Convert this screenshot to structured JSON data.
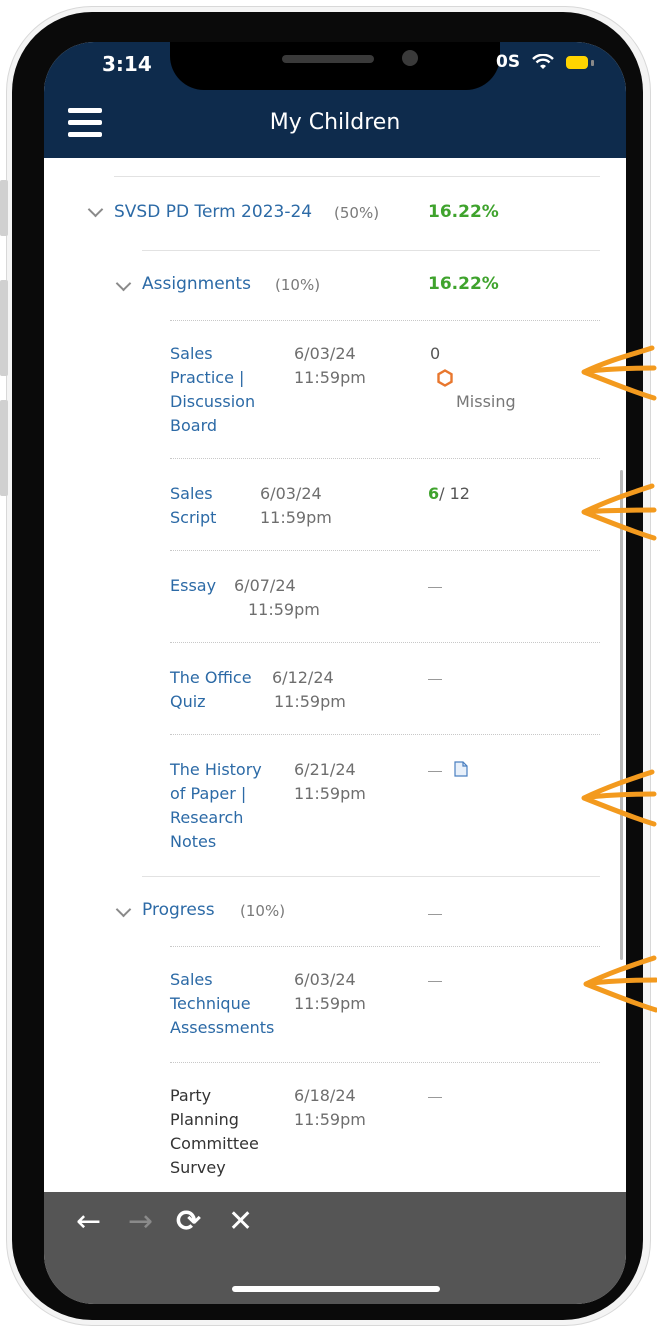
{
  "status": {
    "time": "3:14",
    "carrier_fragment": "0S"
  },
  "header": {
    "title": "My Children"
  },
  "term": {
    "name": "SVSD PD Term 2023-24",
    "weight": "(50%)",
    "grade": "16.22%"
  },
  "categories": [
    {
      "name": "Assignments",
      "weight": "(10%)",
      "grade": "16.22%",
      "items": [
        {
          "title_lines": [
            "Sales",
            "Practice |",
            "Discussion",
            "Board"
          ],
          "date": "6/03/24",
          "time": "11:59pm",
          "score": "0",
          "status": "Missing"
        },
        {
          "title_lines": [
            "Sales",
            "Script"
          ],
          "date": "6/03/24",
          "time": "11:59pm",
          "earned": "6",
          "possible": "/ 12"
        },
        {
          "title_lines": [
            "Essay"
          ],
          "date": "6/07/24",
          "time": "11:59pm"
        },
        {
          "title_lines": [
            "The Office",
            "Quiz"
          ],
          "date": "6/12/24",
          "time": "11:59pm"
        },
        {
          "title_lines": [
            "The History",
            "of Paper |",
            "Research",
            "Notes"
          ],
          "date": "6/21/24",
          "time": "11:59pm"
        }
      ]
    },
    {
      "name": "Progress",
      "weight": "(10%)",
      "items": [
        {
          "title_lines": [
            "Sales",
            "Technique",
            "Assessments"
          ],
          "date": "6/03/24",
          "time": "11:59pm"
        },
        {
          "title_lines": [
            "Party",
            "Planning",
            "Committee",
            "Survey"
          ],
          "date": "6/18/24",
          "time": "11:59pm"
        }
      ]
    }
  ],
  "nav": {
    "back": "←",
    "forward": "→",
    "reload": "⟳",
    "close": "✕"
  },
  "colors": {
    "header": "#0e2b4c",
    "link": "#2c6aa6",
    "green": "#3fa32d",
    "annotation": "#f39a1e",
    "missing_icon": "#e8772e"
  }
}
